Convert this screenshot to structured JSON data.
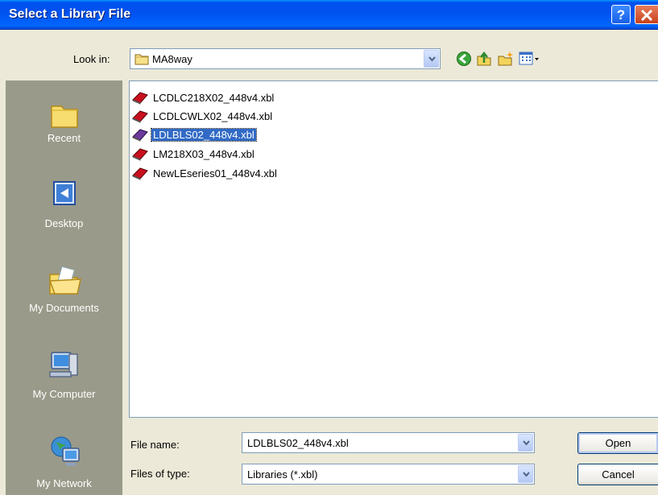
{
  "window": {
    "title": "Select a Library File",
    "help_label": "?",
    "close_icon": "close-icon",
    "title_color": "#0054e3"
  },
  "lookin": {
    "label": "Look in:",
    "value": "MA8way",
    "icons": [
      "folder-icon",
      "back-icon",
      "up-folder-icon",
      "new-folder-icon",
      "views-menu-icon"
    ]
  },
  "places": [
    {
      "label": "Recent",
      "icon": "recent-icon"
    },
    {
      "label": "Desktop",
      "icon": "desktop-icon"
    },
    {
      "label": "My Documents",
      "icon": "my-documents-icon"
    },
    {
      "label": "My Computer",
      "icon": "my-computer-icon"
    },
    {
      "label": "My Network",
      "icon": "my-network-icon"
    }
  ],
  "files": [
    {
      "name": "LCDLC218X02_448v4.xbl",
      "selected": false
    },
    {
      "name": "LCDLCWLX02_448v4.xbl",
      "selected": false
    },
    {
      "name": "LDLBLS02_448v4.xbl",
      "selected": true
    },
    {
      "name": "LM218X03_448v4.xbl",
      "selected": false
    },
    {
      "name": "NewLEseries01_448v4.xbl",
      "selected": false
    }
  ],
  "filename": {
    "label": "File name:",
    "value": "LDLBLS02_448v4.xbl"
  },
  "filetype": {
    "label": "Files of type:",
    "value": "Libraries (*.xbl)"
  },
  "buttons": {
    "open": "Open",
    "cancel": "Cancel"
  },
  "colors": {
    "selection": "#316ac5",
    "places_bar": "#9a9a8a",
    "dialog_bg": "#ece9d8"
  }
}
